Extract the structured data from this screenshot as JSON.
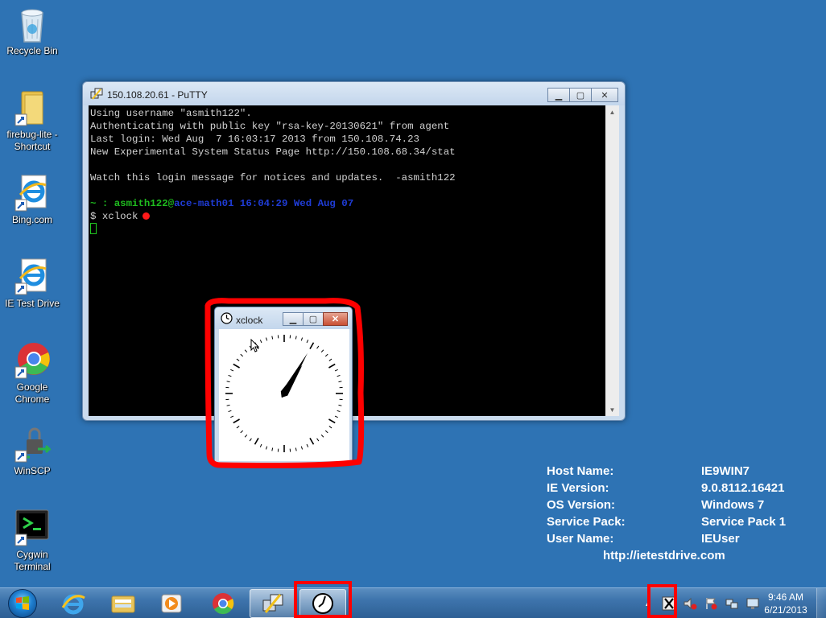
{
  "desktop_icons": [
    {
      "name": "recycle-bin",
      "label": "Recycle Bin"
    },
    {
      "name": "firebug-lite-shortcut",
      "label": "firebug-lite - Shortcut"
    },
    {
      "name": "bing",
      "label": "Bing.com"
    },
    {
      "name": "ie-test-drive",
      "label": "IE Test Drive"
    },
    {
      "name": "google-chrome",
      "label": "Google Chrome"
    },
    {
      "name": "winscp",
      "label": "WinSCP"
    },
    {
      "name": "cygwin-terminal",
      "label": "Cygwin Terminal"
    }
  ],
  "putty": {
    "title": "150.108.20.61 - PuTTY",
    "lines": {
      "l1": "Using username \"asmith122\".",
      "l2": "Authenticating with public key \"rsa-key-20130621\" from agent",
      "l3": "Last login: Wed Aug  7 16:03:17 2013 from 150.108.74.23",
      "l4": "New Experimental System Status Page http://150.108.68.34/stat",
      "l5": "Watch this login message for notices and updates.  -asmith122",
      "prompt_path": "~ : ",
      "prompt_user": "asmith122@",
      "prompt_host": "ace-math01 16:04:29 Wed Aug 07",
      "cmd": "$ xclock"
    }
  },
  "xclock": {
    "title": "xclock",
    "time": {
      "hour": 1,
      "minute": 5
    }
  },
  "sysinfo": {
    "host_name_label": "Host Name:",
    "host_name": "IE9WIN7",
    "ie_version_label": "IE Version:",
    "ie_version": "9.0.8112.16421",
    "os_version_label": "OS Version:",
    "os_version": "Windows 7",
    "service_pack_label": "Service Pack:",
    "service_pack": "Service Pack 1",
    "user_name_label": "User Name:",
    "user_name": "IEUser",
    "url": "http://ietestdrive.com"
  },
  "taskbar": {
    "time": "9:46 AM",
    "date": "6/21/2013",
    "apps": [
      "internet-explorer",
      "windows-explorer",
      "media-player",
      "google-chrome",
      "putty",
      "xclock"
    ]
  },
  "colors": {
    "annotation": "#ff0000",
    "desktop": "#2e73b4"
  }
}
